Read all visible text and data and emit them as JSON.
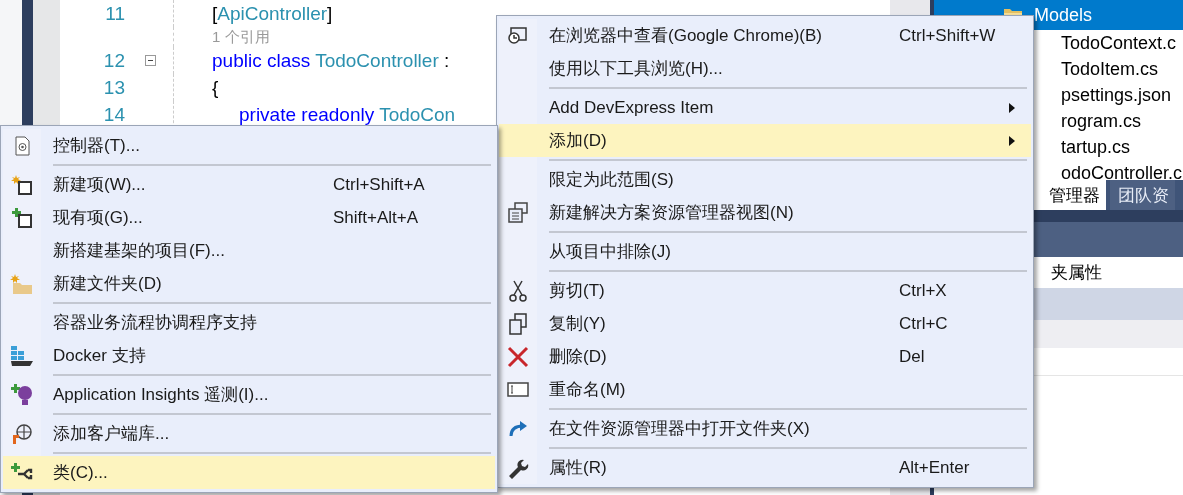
{
  "editor": {
    "lines": [
      {
        "number": "11",
        "tokens": [
          {
            "text": "[",
            "kind": "plain"
          },
          {
            "text": "ApiController",
            "kind": "type"
          },
          {
            "text": "]",
            "kind": "plain"
          }
        ]
      },
      {
        "codelens": "1 个引用"
      },
      {
        "number": "12",
        "expanded": true,
        "tokens": [
          {
            "text": "public class ",
            "kind": "keyword"
          },
          {
            "text": "TodoController",
            "kind": "type"
          },
          {
            "text": " :",
            "kind": "plain"
          }
        ]
      },
      {
        "number": "13",
        "tokens": [
          {
            "text": "{",
            "kind": "plain"
          }
        ]
      },
      {
        "number": "14",
        "indent": true,
        "tokens": [
          {
            "text": "private readonly ",
            "kind": "keyword"
          },
          {
            "text": "TodoCon",
            "kind": "type"
          }
        ]
      }
    ]
  },
  "solution_explorer": {
    "items": [
      {
        "label": "Models",
        "selected": true,
        "kind": "folder"
      },
      {
        "label": "TodoContext.c",
        "selected": false,
        "kind": "file"
      },
      {
        "label": "TodoItem.cs",
        "selected": false,
        "kind": "file"
      },
      {
        "label": "psettings.json",
        "selected": false,
        "kind": "file"
      },
      {
        "label": "rogram.cs",
        "selected": false,
        "kind": "file"
      },
      {
        "label": "tartup.cs",
        "selected": false,
        "kind": "file"
      },
      {
        "label": "odoController.c",
        "selected": false,
        "kind": "file"
      }
    ],
    "tabs": [
      {
        "label": "管理器",
        "selected": true
      },
      {
        "label": "团队资",
        "selected": false
      }
    ]
  },
  "properties": {
    "title": "夹属性"
  },
  "context_menu": {
    "items": [
      {
        "kind": "item",
        "label": "在浏览器中查看(Google Chrome)(B)",
        "shortcut": "Ctrl+Shift+W",
        "selected": false
      },
      {
        "kind": "item",
        "label": "使用以下工具浏览(H)...",
        "selected": false
      },
      {
        "kind": "separator"
      },
      {
        "kind": "item",
        "label": "Add DevExpress Item",
        "submenu": true,
        "selected": false
      },
      {
        "kind": "item",
        "label": "添加(D)",
        "submenu": true,
        "selected": true
      },
      {
        "kind": "separator"
      },
      {
        "kind": "item",
        "label": "限定为此范围(S)",
        "selected": false
      },
      {
        "kind": "item",
        "label": "新建解决方案资源管理器视图(N)",
        "selected": false
      },
      {
        "kind": "separator"
      },
      {
        "kind": "item",
        "label": "从项目中排除(J)",
        "selected": false
      },
      {
        "kind": "separator"
      },
      {
        "kind": "item",
        "label": "剪切(T)",
        "shortcut": "Ctrl+X",
        "selected": false
      },
      {
        "kind": "item",
        "label": "复制(Y)",
        "shortcut": "Ctrl+C",
        "selected": false
      },
      {
        "kind": "item",
        "label": "删除(D)",
        "shortcut": "Del",
        "selected": false
      },
      {
        "kind": "item",
        "label": "重命名(M)",
        "selected": false
      },
      {
        "kind": "separator"
      },
      {
        "kind": "item",
        "label": "在文件资源管理器中打开文件夹(X)",
        "selected": false
      },
      {
        "kind": "separator"
      },
      {
        "kind": "item",
        "label": "属性(R)",
        "shortcut": "Alt+Enter",
        "selected": false
      }
    ]
  },
  "add_submenu": {
    "items": [
      {
        "kind": "item",
        "label": "控制器(T)...",
        "selected": false
      },
      {
        "kind": "separator"
      },
      {
        "kind": "item",
        "label": "新建项(W)...",
        "shortcut": "Ctrl+Shift+A",
        "selected": false
      },
      {
        "kind": "item",
        "label": "现有项(G)...",
        "shortcut": "Shift+Alt+A",
        "selected": false
      },
      {
        "kind": "item",
        "label": "新搭建基架的项目(F)...",
        "selected": false
      },
      {
        "kind": "item",
        "label": "新建文件夹(D)",
        "selected": false
      },
      {
        "kind": "separator"
      },
      {
        "kind": "item",
        "label": "容器业务流程协调程序支持",
        "selected": false
      },
      {
        "kind": "item",
        "label": "Docker 支持",
        "selected": false
      },
      {
        "kind": "separator"
      },
      {
        "kind": "item",
        "label": "Application Insights 遥测(I)...",
        "selected": false
      },
      {
        "kind": "separator"
      },
      {
        "kind": "item",
        "label": "添加客户端库...",
        "selected": false
      },
      {
        "kind": "separator"
      },
      {
        "kind": "item",
        "label": "类(C)...",
        "selected": true
      }
    ]
  }
}
